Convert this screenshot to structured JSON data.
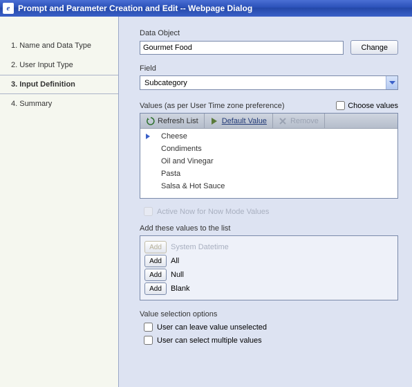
{
  "title": "Prompt and Parameter Creation and Edit -- Webpage Dialog",
  "sidebar": {
    "items": [
      {
        "label": "1. Name and Data Type"
      },
      {
        "label": "2. User Input Type"
      },
      {
        "label": "3. Input Definition"
      },
      {
        "label": "4. Summary"
      }
    ],
    "current_index": 2
  },
  "data_object": {
    "label": "Data Object",
    "value": "Gourmet Food",
    "change_label": "Change"
  },
  "field": {
    "label": "Field",
    "value": "Subcategory"
  },
  "values": {
    "label": "Values (as per User Time zone preference)",
    "choose_label": "Choose values",
    "choose_checked": false,
    "toolbar": {
      "refresh_label": "Refresh List",
      "default_label": "Default Value",
      "remove_label": "Remove"
    },
    "items": [
      "Cheese",
      "Condiments",
      "Oil and Vinegar",
      "Pasta",
      "Salsa & Hot Sauce"
    ],
    "selected_index": 0
  },
  "active_now": {
    "label": "Active Now for Now Mode Values",
    "checked": false,
    "enabled": false
  },
  "add_section": {
    "label": "Add these values to the list",
    "button_label": "Add",
    "rows": [
      {
        "label": "System Datetime",
        "enabled": false
      },
      {
        "label": "All",
        "enabled": true
      },
      {
        "label": "Null",
        "enabled": true
      },
      {
        "label": "Blank",
        "enabled": true
      }
    ]
  },
  "selection_options": {
    "label": "Value selection options",
    "leave_unselected": {
      "label": "User can leave value unselected",
      "checked": false
    },
    "multiple": {
      "label": "User can select multiple values",
      "checked": false
    }
  }
}
